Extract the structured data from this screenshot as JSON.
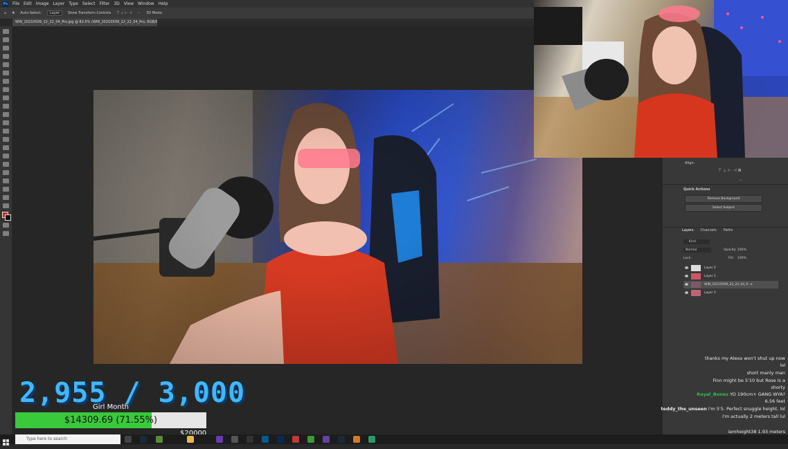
{
  "menubar": {
    "items": [
      "File",
      "Edit",
      "Image",
      "Layer",
      "Type",
      "Select",
      "Filter",
      "3D",
      "View",
      "Window",
      "Help"
    ]
  },
  "options": {
    "auto_select": "Auto-Select:",
    "auto_select_value": "Layer",
    "transform": "Show Transform Controls",
    "mode3d": "3D Mode:"
  },
  "document_tab": "WIN_20210509_22_22_04_Pro.jpg @ 82.6% (WIN_20210509_22_22_04_Pro, RGB/8#) *",
  "properties": {
    "align_label": "Align:",
    "quick_actions_title": "Quick Actions",
    "remove_background": "Remove Background",
    "select_subject": "Select Subject"
  },
  "layers_panel": {
    "tabs": [
      "Layers",
      "Channels",
      "Paths"
    ],
    "filter": "Kind",
    "blend_mode": "Normal",
    "opacity_label": "Opacity:",
    "opacity_value": "100%",
    "lock_label": "Lock:",
    "fill_label": "Fill:",
    "fill_value": "100%",
    "layers": [
      "Layer 2",
      "Layer 1",
      "WIN_20210509_22_22_04_P...o",
      "Layer 5"
    ]
  },
  "chat": [
    {
      "user": "",
      "text": "thanks my Alexa won't shut up now"
    },
    {
      "user": "",
      "text": "lol"
    },
    {
      "user": "",
      "text": "short manly man"
    },
    {
      "user": "",
      "text": "Finn might be 5'10 but Rose is a"
    },
    {
      "user": "",
      "text": "shorty"
    },
    {
      "user": "Royal_Bones",
      "text": "YO 190cm+ GANG WYA?",
      "user_color": "#2fbf4f"
    },
    {
      "user": "",
      "text": "6.56 feet"
    },
    {
      "user": "teddy_the_unseen",
      "text": "i'm 5'5. Perfect snuggle height. lol",
      "user_color": "#dddddd"
    },
    {
      "user": "",
      "text": "i'm actually 2 meters tall lul"
    }
  ],
  "chat_bottom": "iamheight38 1.93 meters",
  "goal": {
    "counter": "2,955 / 3,000",
    "label": "Girl Month",
    "amount_text": "$14309.69 (71.55%)",
    "progress_fraction": 0.7155,
    "sub_amount": "$20000",
    "color_counter": "#3fb8ff",
    "color_bar": "#3ac93a"
  },
  "taskbar": {
    "search_placeholder": "Type here to search"
  },
  "colors": {
    "ps_dark": "#282828",
    "ps_panel": "#383838",
    "accent_red": "#e0231b"
  }
}
